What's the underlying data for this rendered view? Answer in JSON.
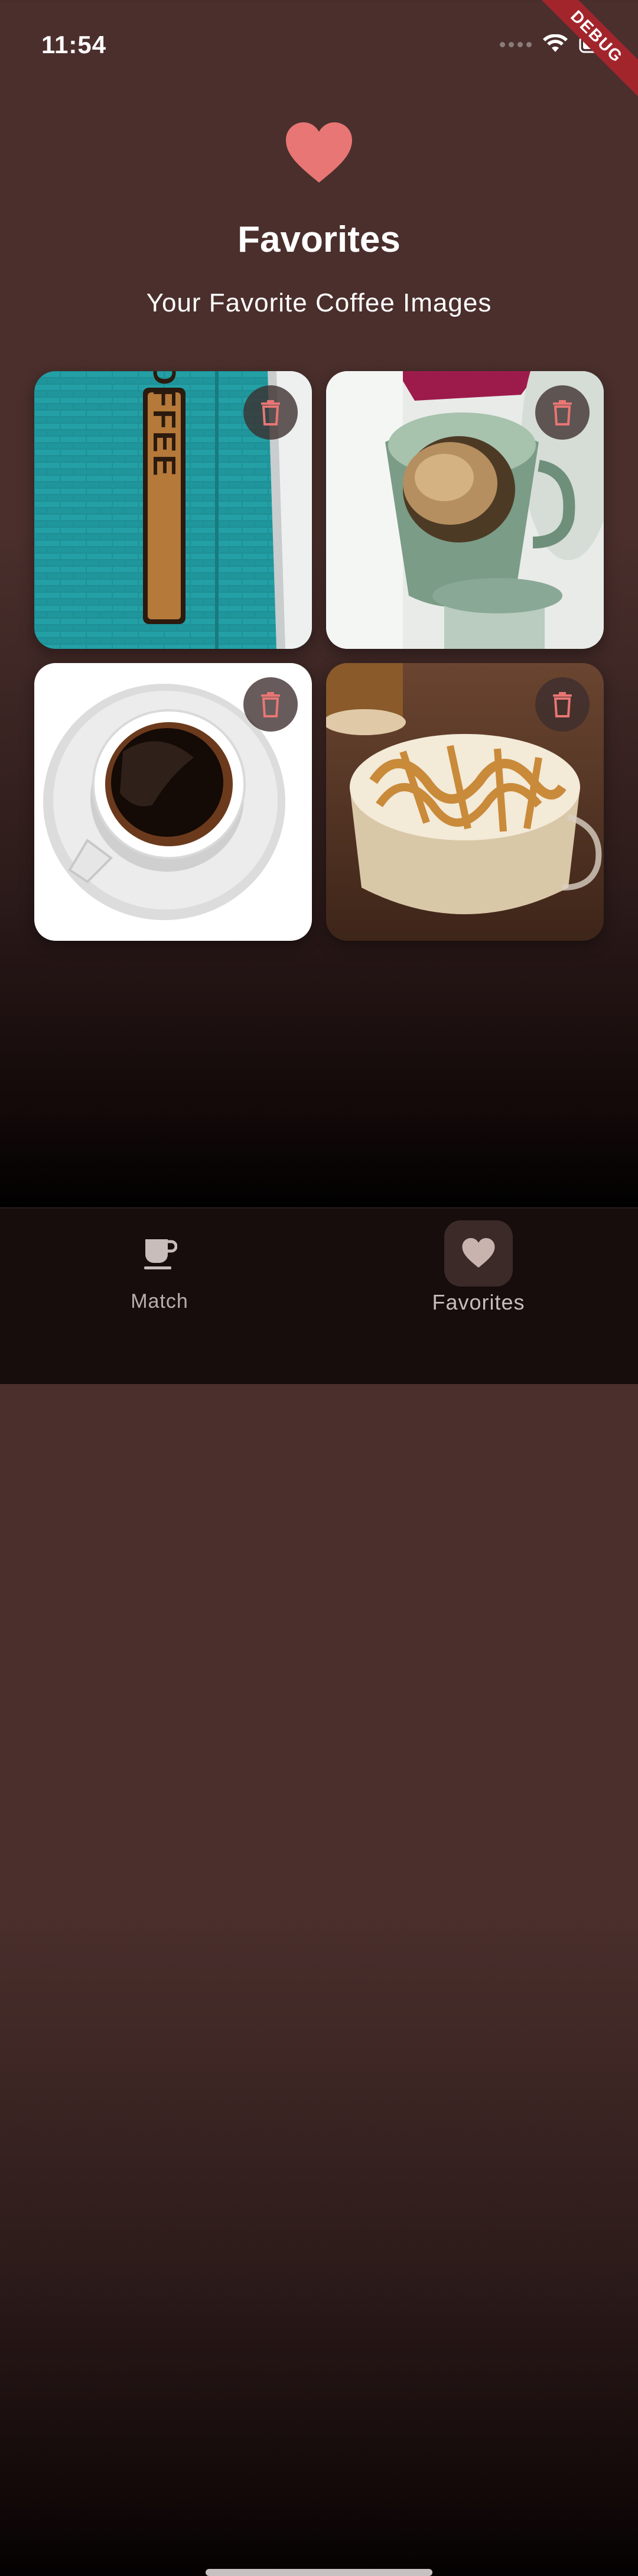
{
  "status_bar": {
    "time": "11:54",
    "debug_label": "DEBUG"
  },
  "header": {
    "icon": "heart-icon",
    "title": "Favorites",
    "subtitle": "Your Favorite Coffee Images"
  },
  "favorites": [
    {
      "image": "coffee-sign-on-teal-brick-wall",
      "sign_text": "COFFEE",
      "delete_icon": "trash-icon"
    },
    {
      "image": "green-pour-over-coffee-dripper",
      "delete_icon": "trash-icon"
    },
    {
      "image": "black-coffee-cup-on-saucer",
      "delete_icon": "trash-icon"
    },
    {
      "image": "caramel-latte-glass-cup",
      "delete_icon": "trash-icon"
    }
  ],
  "bottom_nav": {
    "items": [
      {
        "label": "Match",
        "icon": "coffee-cup-icon",
        "active": false
      },
      {
        "label": "Favorites",
        "icon": "heart-icon",
        "active": true
      }
    ]
  },
  "colors": {
    "accent": "#e87674",
    "background_top": "#4b2f2d",
    "nav_bg": "#160d0c"
  }
}
